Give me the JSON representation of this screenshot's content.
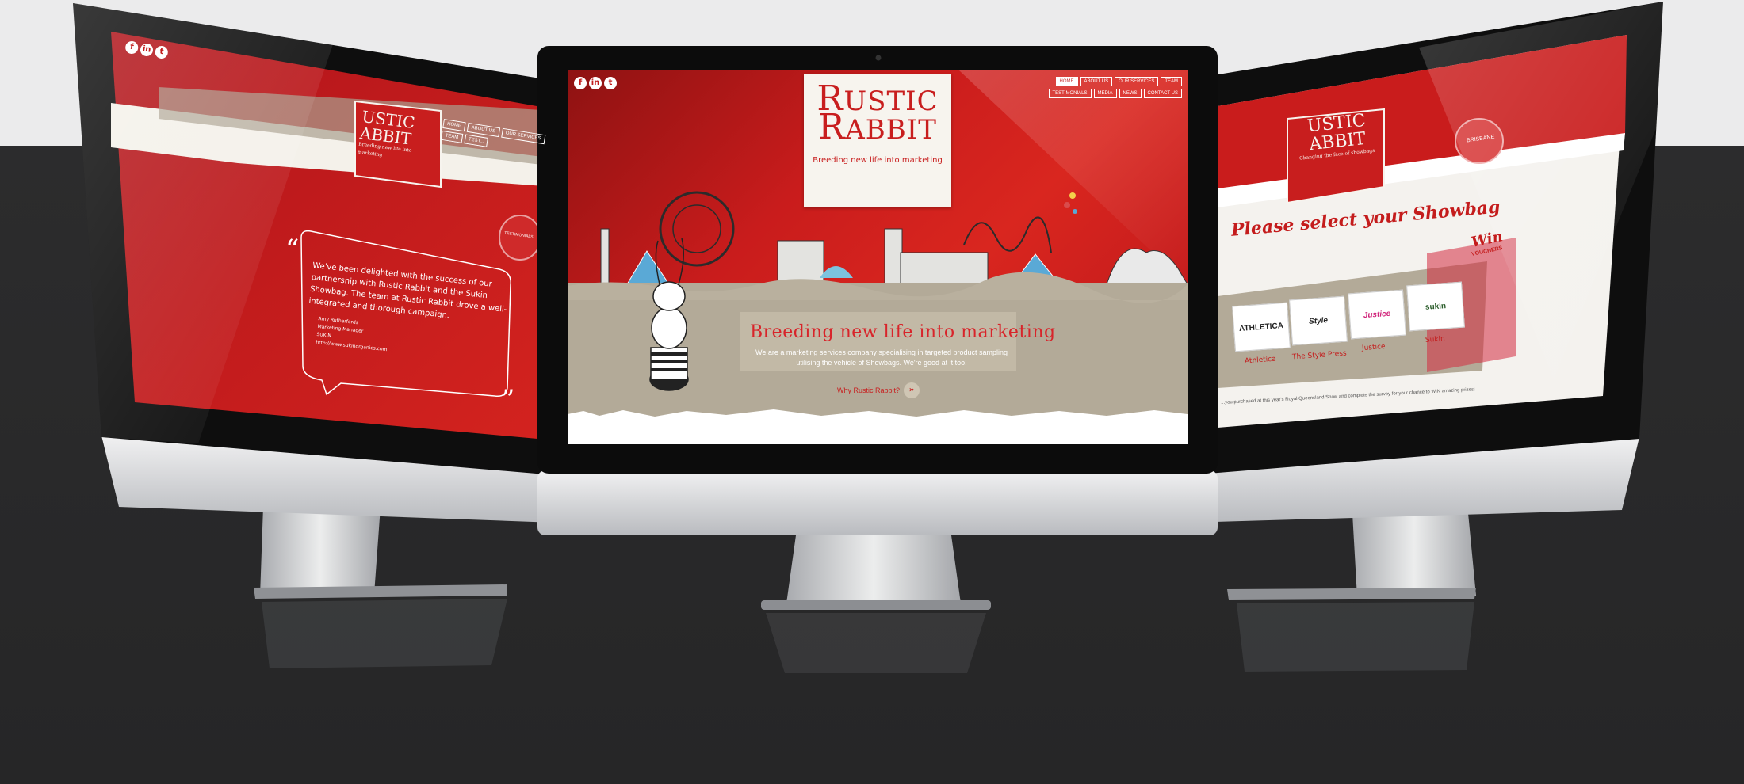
{
  "center_site": {
    "nav": [
      "HOME",
      "ABOUT US",
      "OUR SERVICES",
      "TEAM",
      "TESTIMONIALS",
      "MEDIA",
      "NEWS",
      "CONTACT US"
    ],
    "active_nav": "HOME",
    "logo_line1": "USTIC",
    "logo_line2": "ABBIT",
    "logo_initial_1": "R",
    "logo_initial_2": "R",
    "logo_tagline": "Breeding new life into marketing",
    "headline": "Breeding new life into marketing",
    "blurb": "We are a marketing services company specialising in targeted product sampling utilising the vehicle of Showbags. We're good at it too!",
    "cta": "Why Rustic Rabbit?",
    "cta_icon": "double-chevron-right-icon",
    "social_icons": [
      "f",
      "in",
      "t"
    ]
  },
  "left_site": {
    "nav": [
      "HOME",
      "ABOUT US",
      "OUR SERVICES",
      "TEAM",
      "TEST..."
    ],
    "logo_line1": "USTIC",
    "logo_line2": "ABBIT",
    "logo_tagline": "Breeding new life into marketing",
    "badge": "TESTIMONIALS",
    "quote": "We've been delighted with the success of our partnership with Rustic Rabbit and the Sukin Showbag. The team at Rustic Rabbit drove a well-integrated and thorough campaign.",
    "signature": [
      "Amy Rutherfords",
      "Marketing Manager",
      "SUKIN",
      "http://www.sukinorganics.com"
    ],
    "social_icons": [
      "f",
      "in",
      "t"
    ]
  },
  "right_site": {
    "logo_line1": "USTIC",
    "logo_line2": "ABBIT",
    "logo_tagline": "Changing the face of showbags",
    "badge": "BRISBANE",
    "title": "Please select your Showbag",
    "brands": [
      {
        "card": "ATHLETICA",
        "label": "Athletica"
      },
      {
        "card": "Style",
        "label": "The Style Press"
      },
      {
        "card": "Justice",
        "label": "Justice"
      },
      {
        "card": "sukin",
        "label": "Sukin"
      }
    ],
    "promo": "Win",
    "promo2": "VOUCHERS",
    "footer_note": "...you purchased at this year's Royal Queensland Show and complete the survey for your chance to WIN amazing prizes!"
  },
  "colors": {
    "brand_red": "#c81e1e",
    "tan": "#b3aa98",
    "monitor_silver": "#d7d8da",
    "bezel": "#0d0d0d",
    "background_top": "#ebebec",
    "background_bottom": "#2a2a2b"
  }
}
